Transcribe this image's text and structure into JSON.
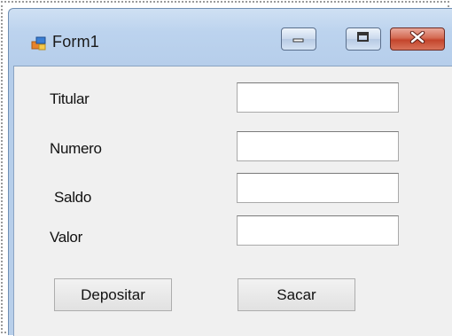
{
  "window": {
    "title": "Form1",
    "controls": {
      "minimize": "minimize-icon",
      "maximize": "maximize-icon",
      "close": "close-icon"
    }
  },
  "form": {
    "fields": [
      {
        "label": "Titular",
        "value": ""
      },
      {
        "label": "Numero",
        "value": ""
      },
      {
        "label": "Saldo",
        "value": ""
      },
      {
        "label": "Valor",
        "value": ""
      }
    ],
    "buttons": {
      "depositar": "Depositar",
      "sacar": "Sacar"
    }
  },
  "colors": {
    "close_button": "#c4452c",
    "client_background": "#f0f0f0",
    "title_gradient": "#bcd3ee"
  }
}
